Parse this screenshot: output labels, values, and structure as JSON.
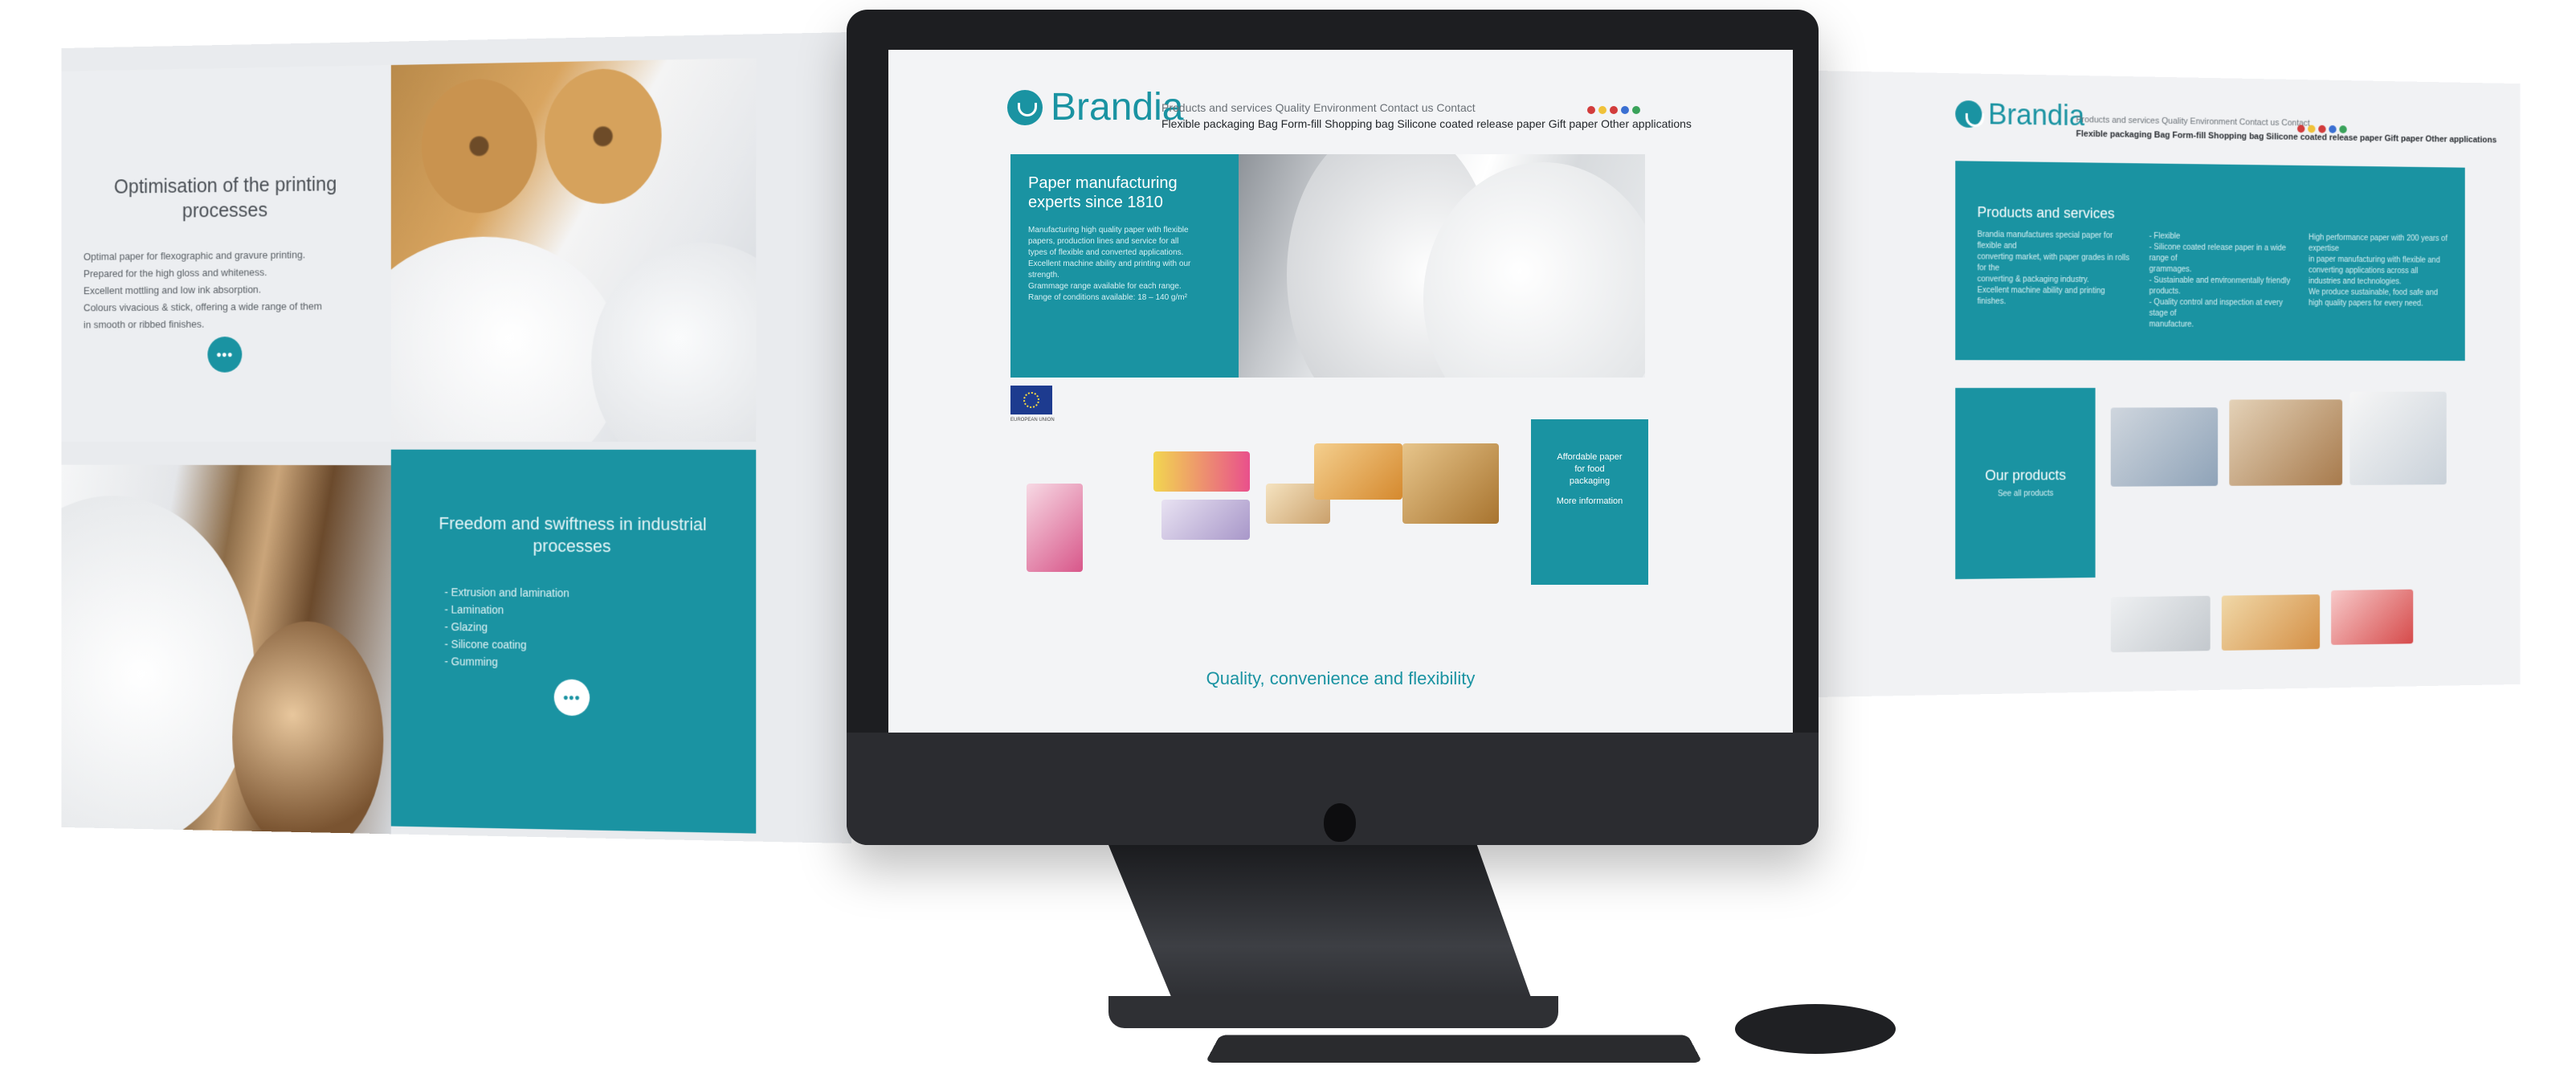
{
  "colors": {
    "brand": "#1a93a2",
    "screen_bg": "#f3f4f6",
    "bezel": "#1d1e21"
  },
  "left_panel": {
    "block1": {
      "title": "Optimisation of the printing processes",
      "lines": [
        "Optimal paper for flexographic and gravure printing.",
        "Prepared for the high gloss and whiteness.",
        "Excellent mottling and low ink absorption.",
        "Colours vivacious & stick, offering a wide range of them",
        "in smooth or ribbed finishes."
      ],
      "more_label": "•••"
    },
    "block2": {
      "title": "Freedom and swiftness in industrial processes",
      "items": [
        "- Extrusion and lamination",
        "- Lamination",
        "- Glazing",
        "- Silicone coating",
        "- Gumming"
      ],
      "more_label": "•••"
    }
  },
  "screen": {
    "brand": "Brandia",
    "nav_primary": "Products and services  Quality  Environment  Contact us  Contact",
    "nav_secondary": "Flexible packaging  Bag  Form-fill  Shopping bag  Silicone coated release paper  Gift paper  Other applications",
    "hero": {
      "title": "Paper manufacturing experts since 1810",
      "body_lines": [
        "Manufacturing high quality paper with flexible",
        "papers, production lines and service for all",
        "types of flexible and converted applications.",
        "Excellent machine ability and printing with our",
        "strength.",
        "Grammage range available for each range.",
        "Range of conditions available: 18 – 140 g/m²"
      ]
    },
    "eu_label": "EUROPEAN UNION",
    "side_box_lines": [
      "Affordable paper",
      "for food",
      "packaging",
      "More information"
    ],
    "tagline": "Quality, convenience and flexibility"
  },
  "right_panel": {
    "brand": "Brandia",
    "nav_primary": "Products and services  Quality  Environment  Contact us  Contact",
    "nav_secondary": "Flexible packaging  Bag  Form-fill  Shopping bag  Silicone coated release paper  Gift paper  Other applications",
    "services_title": "Products and services",
    "col1": [
      "Brandia manufactures special paper for flexible and",
      "converting market, with paper grades in rolls for the",
      "converting & packaging industry.",
      "Excellent machine ability and printing finishes."
    ],
    "col2": [
      "- Flexible",
      "- Silicone coated release paper in a wide range of",
      "  grammages.",
      "- Sustainable and environmentally friendly",
      "  products.",
      "- Quality control and inspection at every stage of",
      "  manufacture."
    ],
    "col3": [
      "High performance paper with 200 years of expertise",
      "in paper manufacturing with flexible and",
      "converting applications across all",
      "industries and technologies.",
      "",
      "We produce sustainable, food safe and",
      "high quality papers for every need."
    ],
    "products_title": "Our products",
    "products_sub": "See all products"
  }
}
